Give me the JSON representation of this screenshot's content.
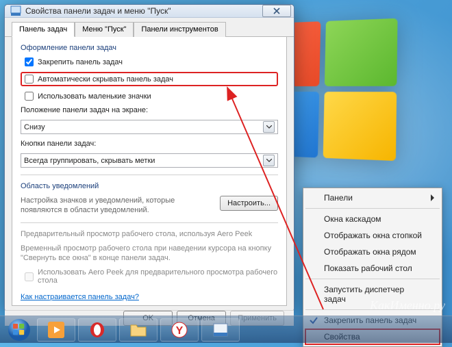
{
  "dialog": {
    "title": "Свойства панели задач и меню \"Пуск\"",
    "tabs": [
      {
        "label": "Панель задач"
      },
      {
        "label": "Меню \"Пуск\""
      },
      {
        "label": "Панели инструментов"
      }
    ],
    "design_group": "Оформление панели задач",
    "lock_taskbar": "Закрепить панель задач",
    "auto_hide": "Автоматически скрывать панель задач",
    "small_icons": "Использовать маленькие значки",
    "position_label": "Положение панели задач на экране:",
    "position_value": "Снизу",
    "buttons_label": "Кнопки панели задач:",
    "buttons_value": "Всегда группировать, скрывать метки",
    "notif_group": "Область уведомлений",
    "notif_desc": "Настройка значков и уведомлений, которые появляются в области уведомлений.",
    "customize_btn": "Настроить...",
    "aero_group": "Предварительный просмотр рабочего стола, используя Aero Peek",
    "aero_desc": "Временный просмотр рабочего стола при наведении курсора на кнопку \"Свернуть все окна\" в конце панели задач.",
    "aero_checkbox": "Использовать Aero Peek для предварительного просмотра рабочего стола",
    "help_link": "Как настраивается панель задач?",
    "ok": "OK",
    "cancel": "Отмена",
    "apply": "Применить"
  },
  "context_menu": {
    "panels": "Панели",
    "cascade": "Окна каскадом",
    "stack": "Отображать окна стопкой",
    "side": "Отображать окна рядом",
    "show_desktop": "Показать рабочий стол",
    "taskmgr": "Запустить диспетчер задач",
    "lock": "Закрепить панель задач",
    "properties": "Свойства"
  },
  "watermark": "КакИменно.ру"
}
